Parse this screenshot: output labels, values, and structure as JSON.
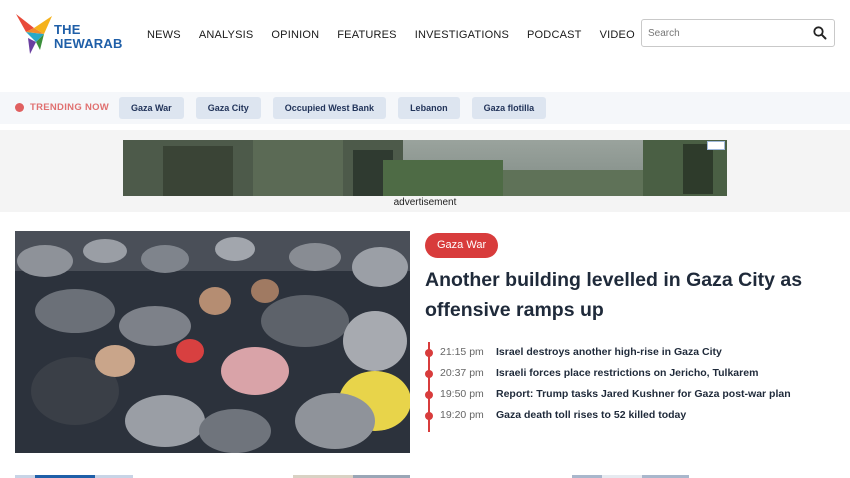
{
  "header": {
    "logo_line1": "THE",
    "logo_line2": "NEWARAB",
    "nav": [
      {
        "label": "NEWS"
      },
      {
        "label": "ANALYSIS"
      },
      {
        "label": "OPINION"
      },
      {
        "label": "FEATURES"
      },
      {
        "label": "INVESTIGATIONS"
      },
      {
        "label": "PODCAST"
      },
      {
        "label": "VIDEO"
      }
    ],
    "search_placeholder": "Search"
  },
  "trending": {
    "label": "TRENDING NOW",
    "tags": [
      "Gaza War",
      "Gaza City",
      "Occupied West Bank",
      "Lebanon",
      "Gaza flotilla"
    ]
  },
  "ad": {
    "label": "advertisement"
  },
  "main_story": {
    "category": "Gaza War",
    "headline": "Another building levelled in Gaza City as offensive ramps up",
    "live_updates": [
      {
        "time": "21:15 pm",
        "text": "Israel destroys another high-rise in Gaza City"
      },
      {
        "time": "20:37 pm",
        "text": "Israeli forces place restrictions on Jericho, Tulkarem"
      },
      {
        "time": "19:50 pm",
        "text": "Report: Trump tasks Jared Kushner for Gaza post-war plan"
      },
      {
        "time": "19:20 pm",
        "text": "Gaza death toll rises to 52 killed today"
      }
    ]
  },
  "colors": {
    "brand_blue": "#1f5fa8",
    "accent_red": "#d83c3c",
    "tag_bg": "#dde5f0"
  },
  "icons": {
    "logo": "hummingbird-logo-icon",
    "search": "search-icon",
    "trending": "red-dot-icon"
  }
}
